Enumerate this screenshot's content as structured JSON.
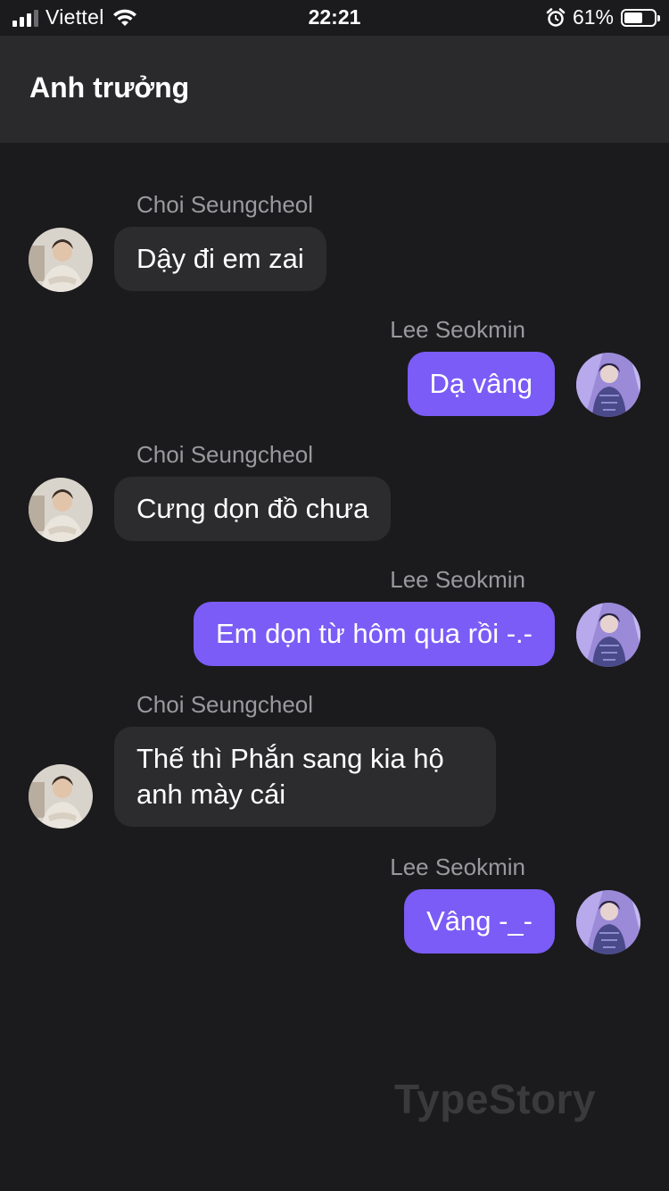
{
  "status_bar": {
    "carrier": "Viettel",
    "time": "22:21",
    "battery_percent_label": "61%",
    "battery_level": 0.61,
    "icons": [
      "signal-bars-icon",
      "wifi-icon",
      "alarm-clock-icon",
      "battery-icon"
    ]
  },
  "header": {
    "title": "Anh trưởng"
  },
  "messages": [
    {
      "sender": "Choi Seungcheol",
      "text": "Dậy đi em zai",
      "direction": "incoming"
    },
    {
      "sender": "Lee Seokmin",
      "text": "Dạ vâng",
      "direction": "outgoing"
    },
    {
      "sender": "Choi Seungcheol",
      "text": "Cưng dọn đồ chưa",
      "direction": "incoming"
    },
    {
      "sender": "Lee Seokmin",
      "text": "Em dọn từ hôm qua rồi -.-",
      "direction": "outgoing"
    },
    {
      "sender": "Choi Seungcheol",
      "text": "Thế thì Phắn sang kia hộ anh mày cái",
      "direction": "incoming"
    },
    {
      "sender": "Lee Seokmin",
      "text": "Vâng -_-",
      "direction": "outgoing"
    }
  ],
  "watermark": "TypeStory",
  "colors": {
    "background": "#1b1b1d",
    "header": "#2a2a2c",
    "incoming_bubble": "#2c2c2f",
    "outgoing_bubble": "#7b5cf6",
    "sender_name": "#9a9a9e"
  }
}
